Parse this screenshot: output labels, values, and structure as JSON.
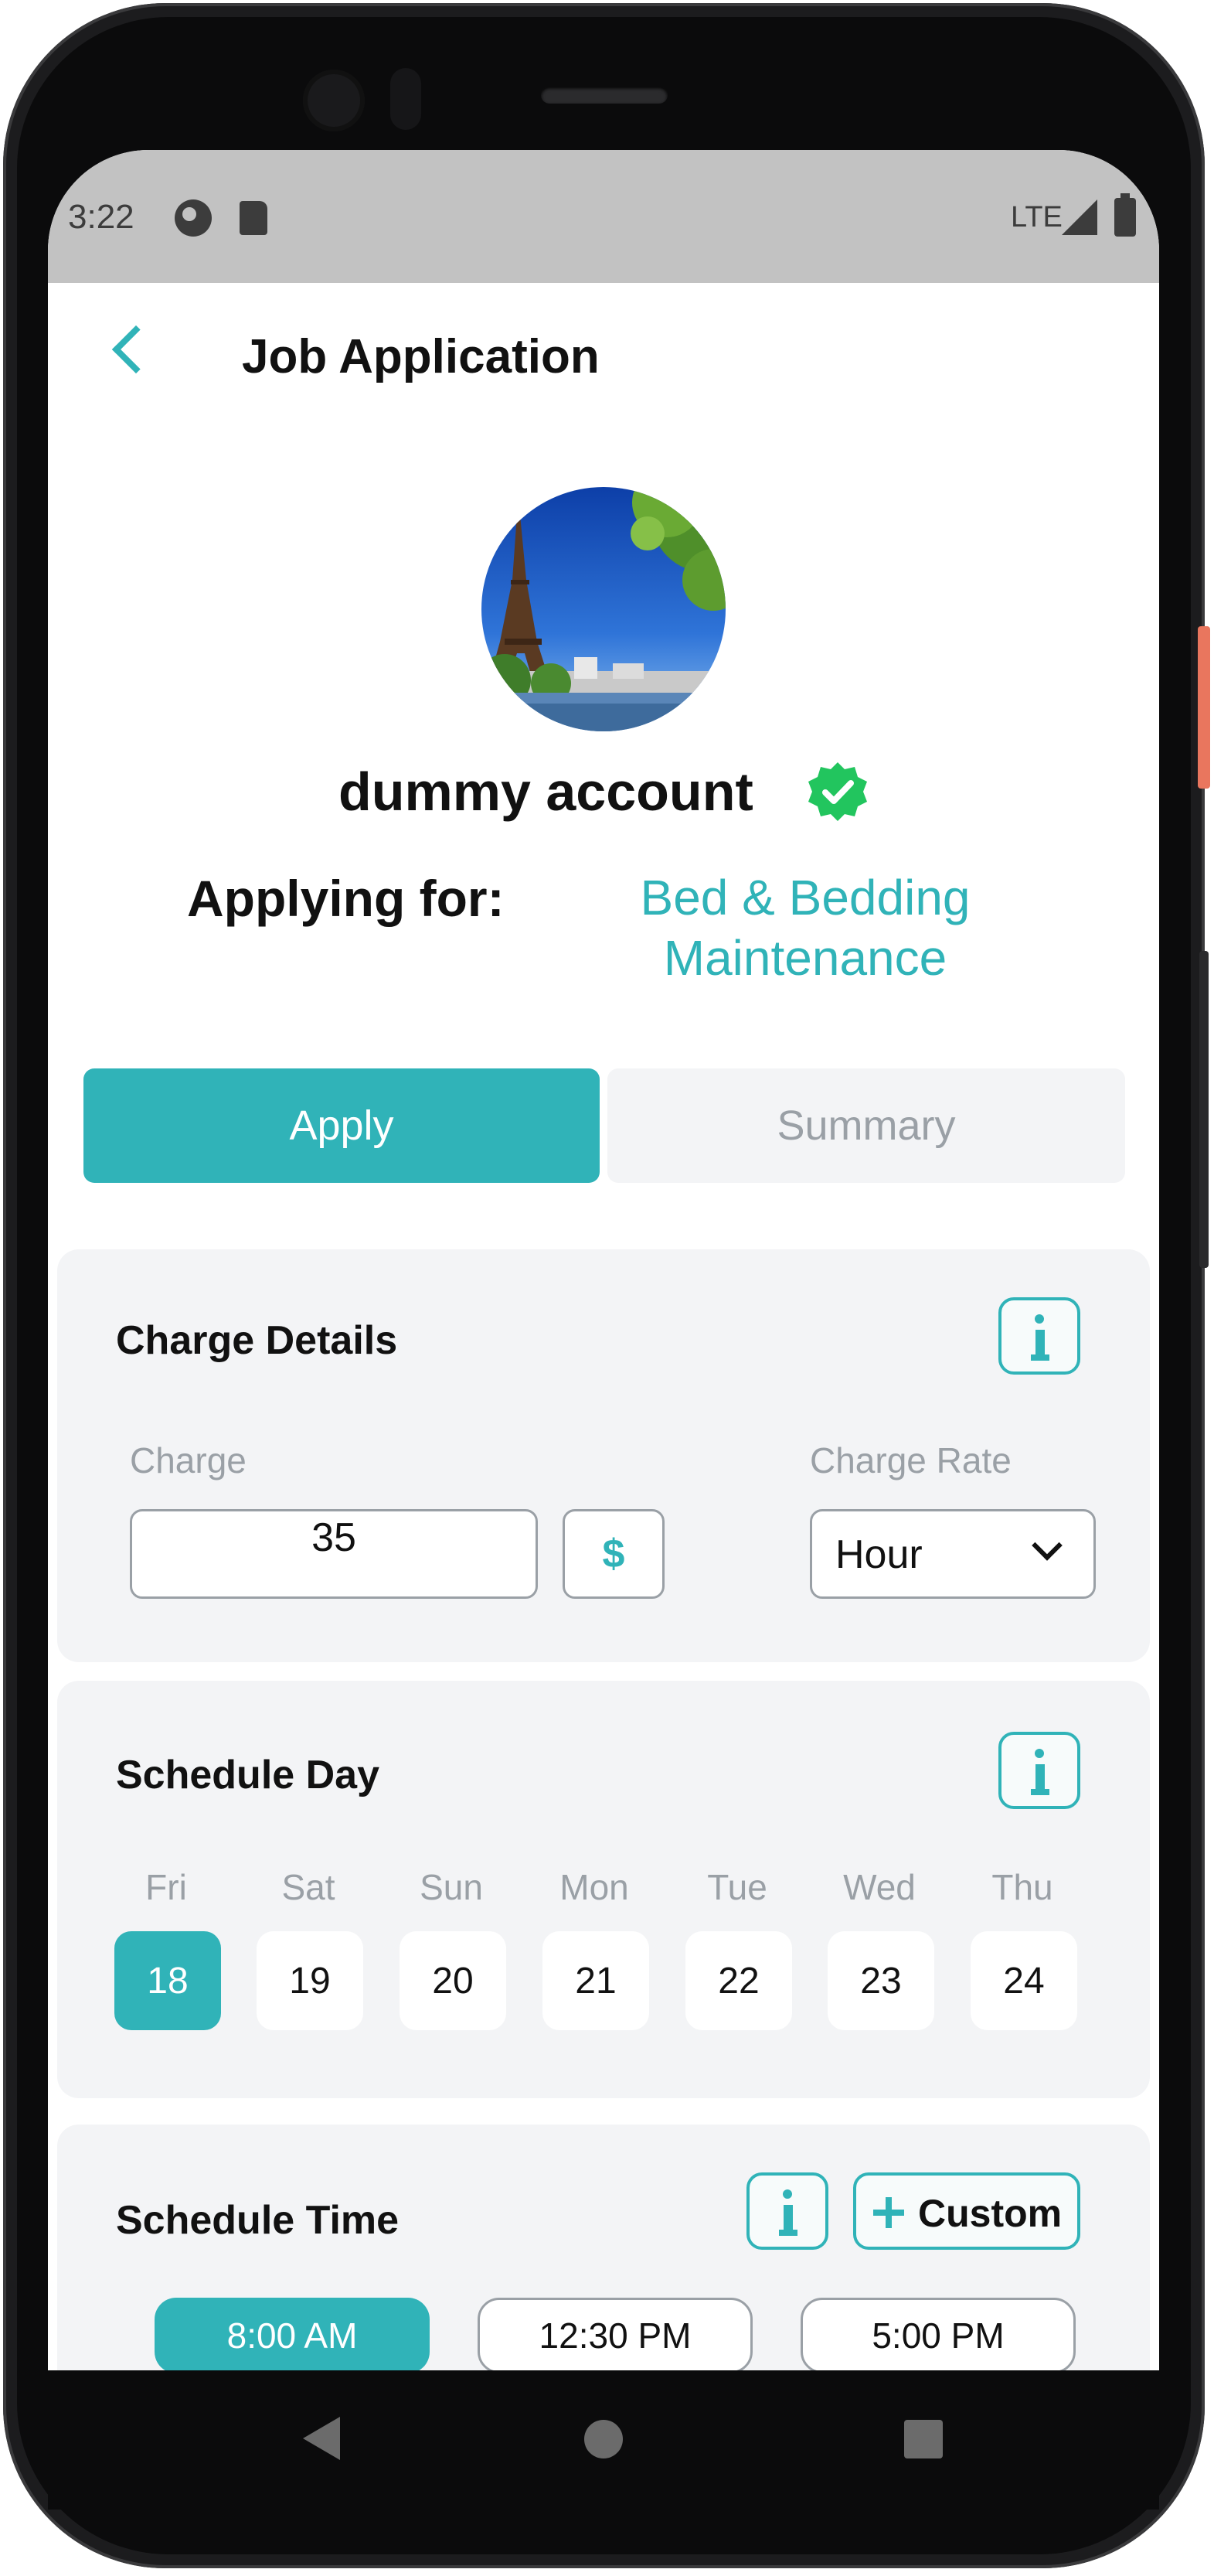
{
  "status_bar": {
    "time": "3:22",
    "network": "LTE"
  },
  "header": {
    "title": "Job Application"
  },
  "profile": {
    "name": "dummy account"
  },
  "applying": {
    "label": "Applying for:",
    "job_line1": "Bed & Bedding",
    "job_line2": "Maintenance"
  },
  "tabs": [
    {
      "label": "Apply",
      "active": true
    },
    {
      "label": "Summary",
      "active": false
    }
  ],
  "charge_details": {
    "title": "Charge Details",
    "charge_label": "Charge",
    "charge_value": "35",
    "currency_symbol": "$",
    "rate_label": "Charge Rate",
    "rate_value": "Hour"
  },
  "schedule_day": {
    "title": "Schedule Day",
    "days": [
      {
        "name": "Fri",
        "date": "18",
        "selected": true
      },
      {
        "name": "Sat",
        "date": "19",
        "selected": false
      },
      {
        "name": "Sun",
        "date": "20",
        "selected": false
      },
      {
        "name": "Mon",
        "date": "21",
        "selected": false
      },
      {
        "name": "Tue",
        "date": "22",
        "selected": false
      },
      {
        "name": "Wed",
        "date": "23",
        "selected": false
      },
      {
        "name": "Thu",
        "date": "24",
        "selected": false
      }
    ]
  },
  "schedule_time": {
    "title": "Schedule Time",
    "custom_label": "Custom",
    "times": [
      {
        "label": "8:00 AM",
        "selected": true
      },
      {
        "label": "12:30 PM",
        "selected": false
      },
      {
        "label": "5:00 PM",
        "selected": false
      }
    ]
  },
  "colors": {
    "accent": "#30b3b8",
    "verified": "#22c55e",
    "card_bg": "#f3f4f6"
  }
}
